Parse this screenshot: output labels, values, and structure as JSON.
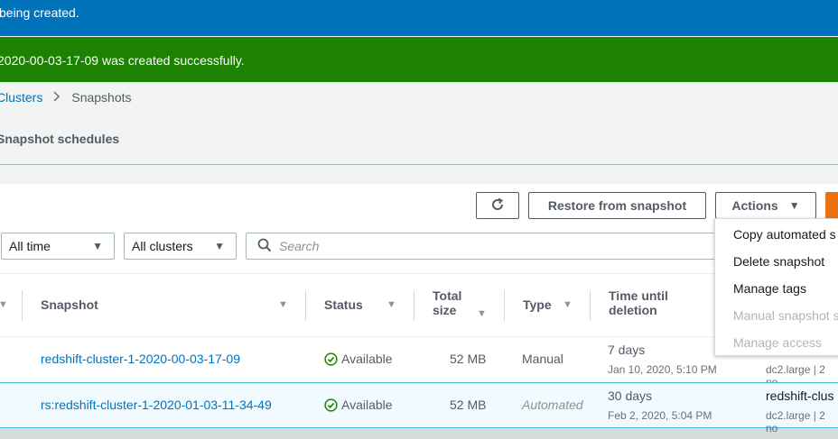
{
  "notifications": {
    "info": "being created.",
    "success": "2020-00-03-17-09 was created successfully."
  },
  "breadcrumb": {
    "parent": "Clusters",
    "current": "Snapshots"
  },
  "subnav": {
    "schedules": "Snapshot schedules"
  },
  "toolbar": {
    "refresh_icon": "refresh-icon",
    "restore_label": "Restore from snapshot",
    "actions_label": "Actions"
  },
  "filters": {
    "time": "All time",
    "clusters": "All clusters",
    "search_placeholder": "Search"
  },
  "table": {
    "headers": {
      "snapshot": "Snapshot",
      "status": "Status",
      "size_line1": "Total",
      "size_line2": "size",
      "type": "Type",
      "time_line1": "Time until",
      "time_line2": "deletion"
    },
    "rows": [
      {
        "snapshot": "redshift-cluster-1-2020-00-03-17-09",
        "status": "Available",
        "size": "52 MB",
        "type": "Manual",
        "time": "7 days",
        "time_date": "Jan 10, 2020, 5:10 PM",
        "cluster": "",
        "node": "dc2.large | 2 no"
      },
      {
        "snapshot": "rs:redshift-cluster-1-2020-01-03-11-34-49",
        "status": "Available",
        "size": "52 MB",
        "type": "Automated",
        "time": "30 days",
        "time_date": "Feb 2, 2020, 5:04 PM",
        "cluster": "redshift-clus",
        "node": "dc2.large | 2 no"
      }
    ]
  },
  "actions_menu": {
    "items": [
      {
        "label": "Copy automated s",
        "enabled": true
      },
      {
        "label": "Delete snapshot",
        "enabled": true
      },
      {
        "label": "Manage tags",
        "enabled": true
      },
      {
        "label": "Manual snapshot s",
        "enabled": false
      },
      {
        "label": "Manage access",
        "enabled": false
      }
    ]
  },
  "colors": {
    "info_banner": "#0073bb",
    "success_banner": "#1d8102",
    "primary_button": "#ec7211",
    "link": "#0073bb",
    "available": "#1d8102"
  }
}
